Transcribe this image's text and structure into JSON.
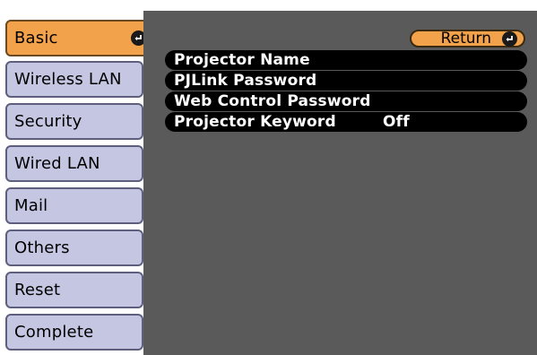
{
  "sidebar": {
    "items": [
      {
        "label": "Basic"
      },
      {
        "label": "Wireless LAN"
      },
      {
        "label": "Security"
      },
      {
        "label": "Wired LAN"
      },
      {
        "label": "Mail"
      },
      {
        "label": "Others"
      },
      {
        "label": "Reset"
      },
      {
        "label": "Complete"
      }
    ],
    "active_icon": "enter-icon"
  },
  "header": {
    "return_label": "Return",
    "return_icon": "enter-icon"
  },
  "main": {
    "rows": [
      {
        "label": "Projector Name",
        "value": ""
      },
      {
        "label": "PJLink Password",
        "value": ""
      },
      {
        "label": "Web Control Password",
        "value": ""
      },
      {
        "label": "Projector Keyword",
        "value": "Off"
      }
    ]
  },
  "colors": {
    "accent": "#f2a24a",
    "sidebar_item": "#c4c6e2",
    "panel": "#5a5a5a",
    "row": "#000000"
  }
}
